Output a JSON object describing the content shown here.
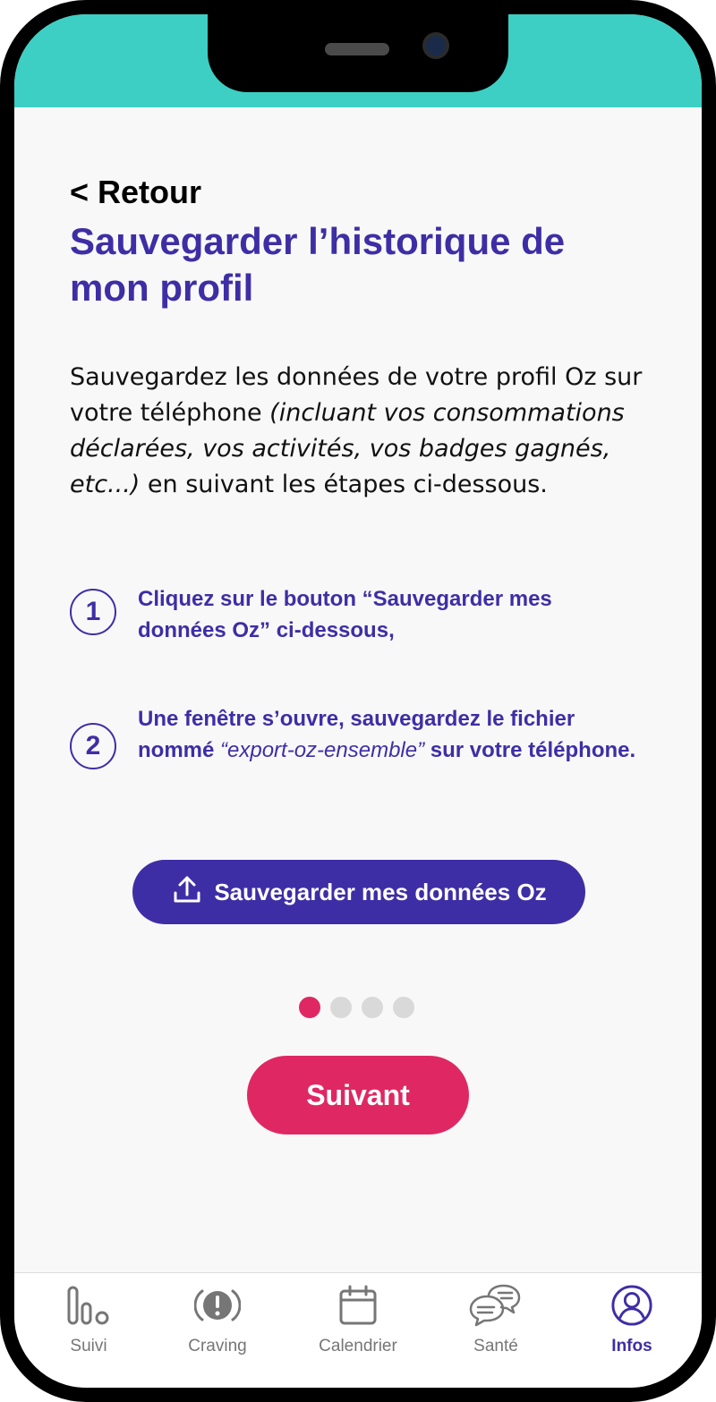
{
  "nav": {
    "back_label": "< Retour"
  },
  "page": {
    "title": "Sauvegarder l’historique de mon profil",
    "intro_plain": "Sauvegardez les données de votre profil Oz sur votre téléphone ",
    "intro_italic": "(incluant vos consommations déclarées, vos activités, vos badges gagnés, etc...)",
    "intro_end": " en suivant les étapes ci-dessous."
  },
  "steps": [
    {
      "number": "1",
      "text": "Cliquez sur le bouton “Sauvegarder mes données Oz” ci-dessous,"
    },
    {
      "number": "2",
      "text_before": "Une fenêtre s’ouvre, sauvegardez le fichier nommé ",
      "text_italic": "“export-oz-ensemble”",
      "text_after": " sur votre téléphone."
    }
  ],
  "save_button": {
    "label": "Sauvegarder mes données Oz",
    "icon": "upload-icon"
  },
  "pagination": {
    "current": 1,
    "total": 4
  },
  "next_button": {
    "label": "Suivant"
  },
  "tabbar": {
    "items": [
      {
        "label": "Suivi",
        "icon": "chart-icon"
      },
      {
        "label": "Craving",
        "icon": "alert-icon"
      },
      {
        "label": "Calendrier",
        "icon": "calendar-icon"
      },
      {
        "label": "Santé",
        "icon": "chat-icon"
      },
      {
        "label": "Infos",
        "icon": "profile-icon",
        "active": true
      }
    ]
  },
  "colors": {
    "primary": "#3e2ea5",
    "accent": "#df2863",
    "header": "#3dcfc3",
    "muted": "#767676"
  }
}
